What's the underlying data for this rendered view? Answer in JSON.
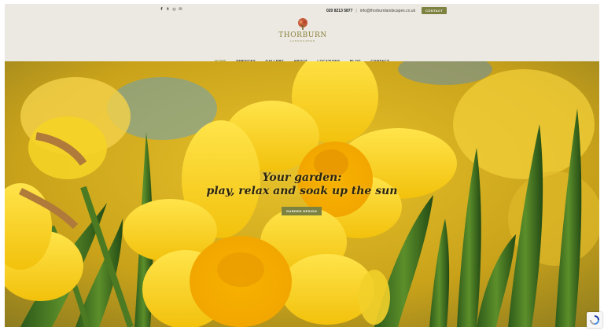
{
  "header": {
    "social_icons": [
      {
        "name": "facebook-icon",
        "glyph": "f"
      },
      {
        "name": "twitter-icon",
        "glyph": "t"
      },
      {
        "name": "instagram-icon",
        "glyph": "◎"
      },
      {
        "name": "email-icon",
        "glyph": "✉"
      }
    ],
    "phone": "020 8213 5877",
    "separator": "|",
    "email": "info@thorburnlandscapes.co.uk",
    "contact_button": "CONTACT",
    "accent_color": "#7d8240"
  },
  "logo": {
    "name": "THORBURN",
    "sub": "LANDSCAPES",
    "icon": "tree-icon"
  },
  "nav": {
    "items": [
      "HOME",
      "SERVICES",
      "GALLERY",
      "ABOUT",
      "LOCATIONS",
      "BLOG",
      "CONTACT"
    ],
    "active": "HOME"
  },
  "hero": {
    "headline_1": "Your garden:",
    "headline_2": "play, relax and soak up the sun",
    "button": "GARDEN DESIGN",
    "image": "daffodils-photo"
  },
  "recaptcha": {
    "icon": "recaptcha-icon"
  }
}
